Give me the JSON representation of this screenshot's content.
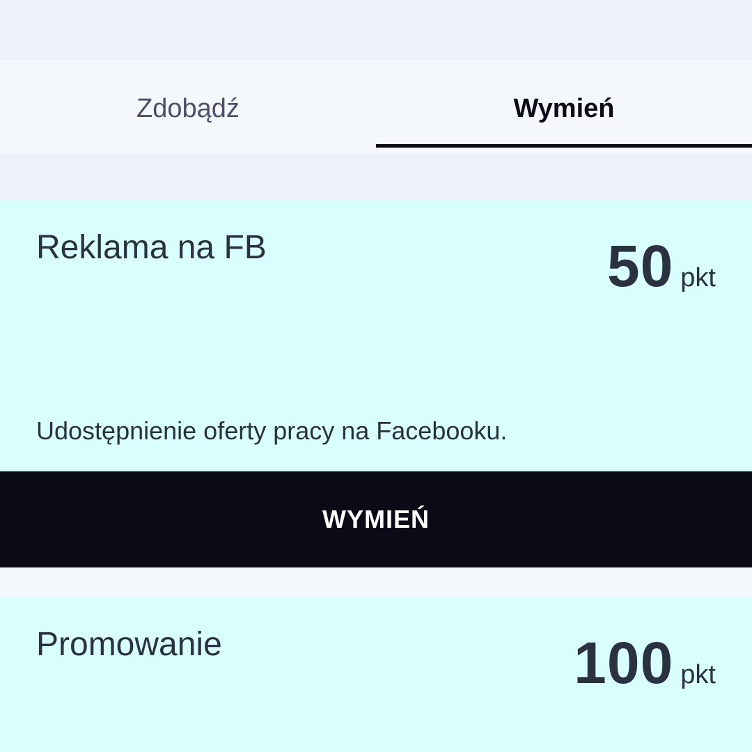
{
  "tabs": [
    {
      "label": "Zdobądź",
      "active": false
    },
    {
      "label": "Wymień",
      "active": true
    }
  ],
  "rewards": [
    {
      "title": "Reklama na FB",
      "points": "50",
      "unit": "pkt",
      "description": "Udostępnienie oferty pracy na Facebooku.",
      "button_label": "WYMIEŃ"
    },
    {
      "title": "Promowanie",
      "points": "100",
      "unit": "pkt"
    }
  ],
  "colors": {
    "card_background": "#d9fefe",
    "button_background": "#0a0b16",
    "active_tab_text": "#0b0c17",
    "inactive_tab_text": "#4c4f6a",
    "body_text": "#2a3140"
  }
}
